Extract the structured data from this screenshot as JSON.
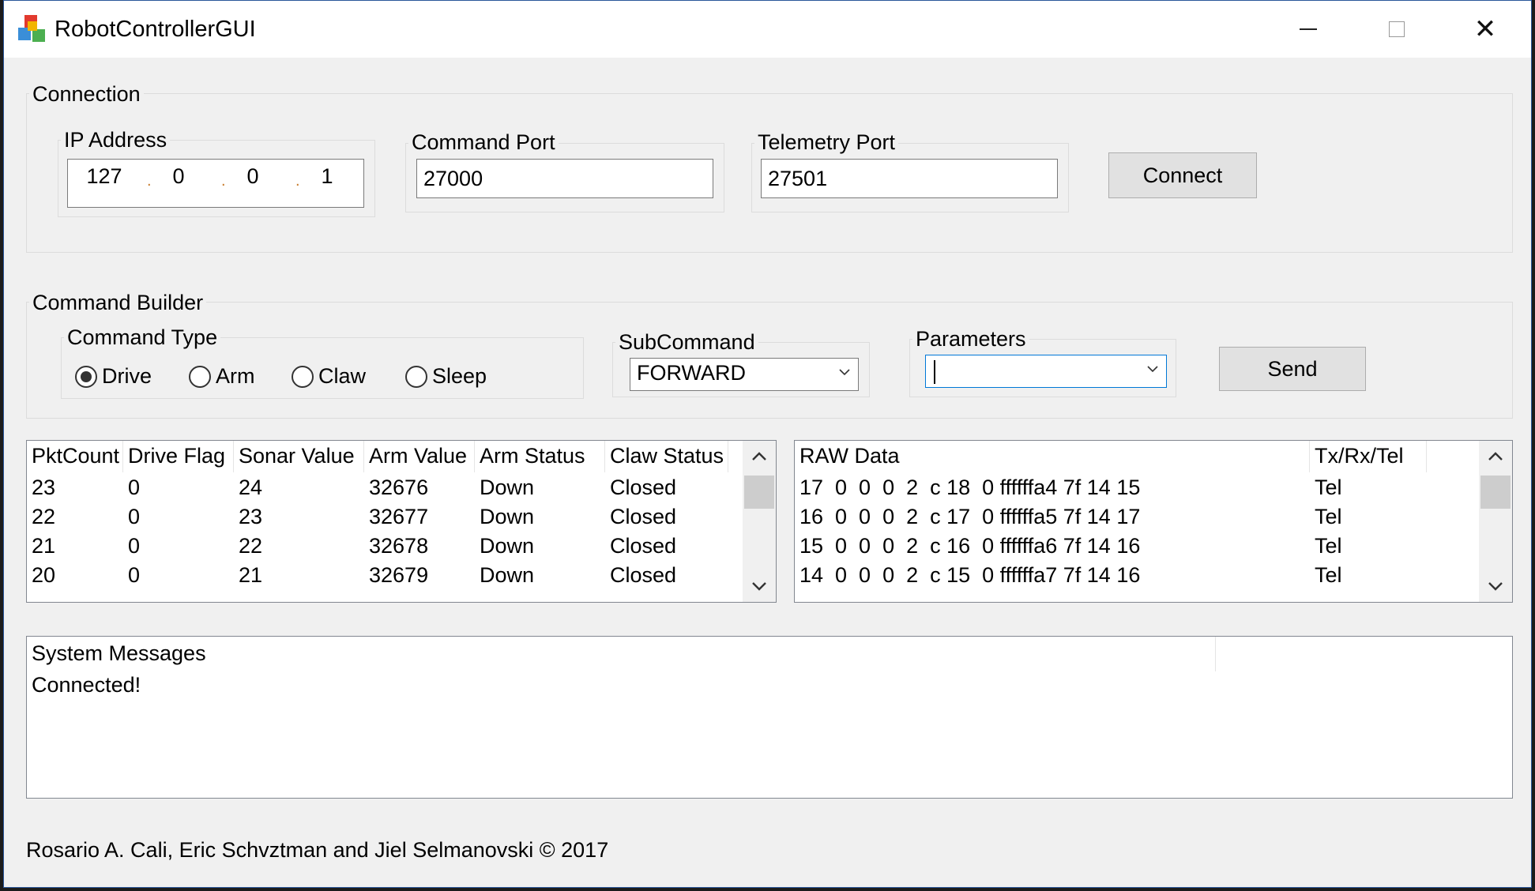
{
  "window": {
    "title": "RobotControllerGUI",
    "icon": "multicolor-cubes-app-icon"
  },
  "connection": {
    "title": "Connection",
    "ip_label": "IP Address",
    "ip": [
      "127",
      "0",
      "0",
      "1"
    ],
    "cmd_port_label": "Command Port",
    "cmd_port": "27000",
    "tel_port_label": "Telemetry Port",
    "tel_port": "27501",
    "connect_label": "Connect"
  },
  "builder": {
    "title": "Command Builder",
    "type_label": "Command Type",
    "types": [
      "Drive",
      "Arm",
      "Claw",
      "Sleep"
    ],
    "selected_type": "Drive",
    "sub_label": "SubCommand",
    "sub_value": "FORWARD",
    "params_label": "Parameters",
    "params_value": "",
    "send_label": "Send"
  },
  "telemetry": {
    "columns": [
      "PktCount",
      "Drive Flag",
      "Sonar Value",
      "Arm Value",
      "Arm Status",
      "Claw Status"
    ],
    "rows": [
      [
        "23",
        "0",
        "24",
        "32676",
        "Down",
        "Closed"
      ],
      [
        "22",
        "0",
        "23",
        "32677",
        "Down",
        "Closed"
      ],
      [
        "21",
        "0",
        "22",
        "32678",
        "Down",
        "Closed"
      ],
      [
        "20",
        "0",
        "21",
        "32679",
        "Down",
        "Closed"
      ]
    ]
  },
  "raw": {
    "columns": [
      "RAW Data",
      "Tx/Rx/Tel"
    ],
    "rows": [
      [
        "17  0  0  0  2  c 18  0 ffffffa4 7f 14 15",
        "Tel"
      ],
      [
        "16  0  0  0  2  c 17  0 ffffffa5 7f 14 17",
        "Tel"
      ],
      [
        "15  0  0  0  2  c 16  0 ffffffa6 7f 14 16",
        "Tel"
      ],
      [
        "14  0  0  0  2  c 15  0 ffffffa7 7f 14 16",
        "Tel"
      ]
    ]
  },
  "system": {
    "header": "System Messages",
    "messages": [
      "Connected!"
    ]
  },
  "footer": "Rosario A. Cali, Eric Schvztman and Jiel Selmanovski © 2017"
}
